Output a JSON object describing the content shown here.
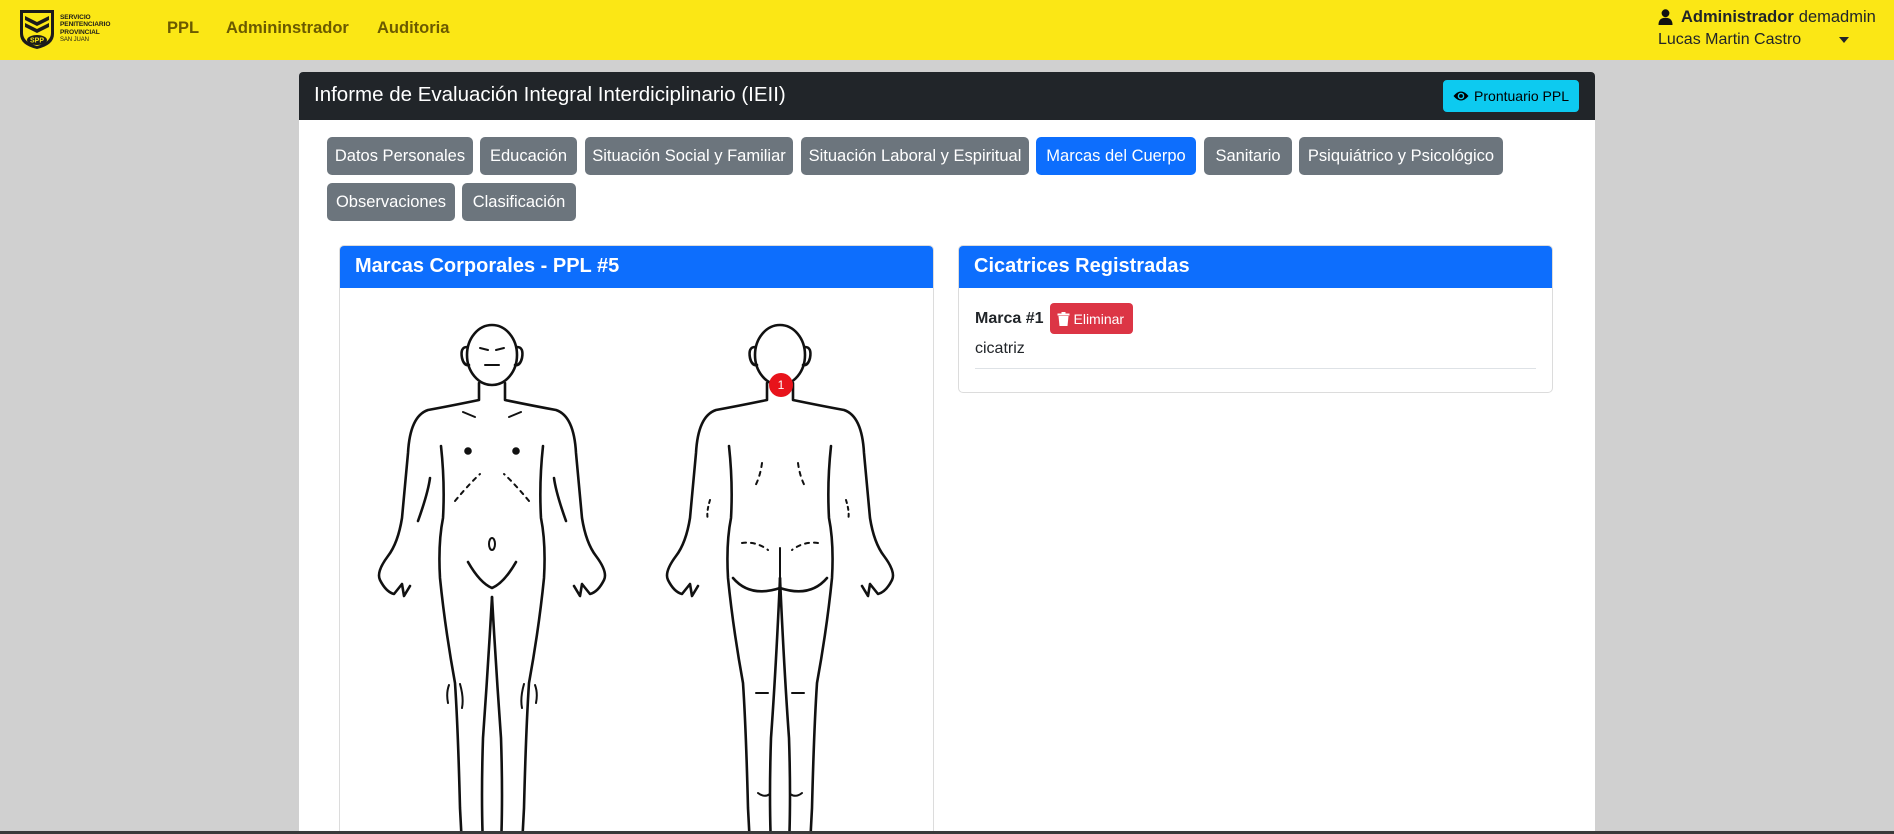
{
  "navbar": {
    "logo": {
      "line1": "Servicio",
      "line2": "Penitenciario",
      "line3": "Provincial",
      "line4": "San Juan",
      "badge": "SPP"
    },
    "links": [
      "PPL",
      "Admininstrador",
      "Auditoria"
    ],
    "user": {
      "role": "Administrador",
      "username": "demadmin",
      "full_name": "Lucas Martin Castro",
      "icon": "user-icon"
    }
  },
  "card": {
    "title": "Informe de Evaluación Integral Interdiciplinario (IEII)",
    "prontuario_button": "Prontuario PPL",
    "prontuario_icon": "eye-icon"
  },
  "tabs": [
    "Datos Personales",
    "Educación",
    "Situación Social y Familiar",
    "Situación Laboral y Espiritual",
    "Marcas del Cuerpo",
    "Sanitario",
    "Psiquiátrico y Psicológico",
    "Observaciones",
    "Clasificación"
  ],
  "active_tab": "Marcas del Cuerpo",
  "body_panel": {
    "title": "Marcas Corporales - PPL #5",
    "markers": [
      "1"
    ]
  },
  "scars_panel": {
    "title": "Cicatrices Registradas",
    "items": [
      {
        "label": "Marca #1",
        "delete_label": "Eliminar",
        "description": "cicatriz"
      }
    ]
  },
  "colors": {
    "navbar": "#fbe715",
    "header_dark": "#212529",
    "primary": "#0d6efd",
    "secondary": "#6c757d",
    "info": "#0dcaf0",
    "danger": "#dc3545",
    "marker": "#e8131b"
  }
}
